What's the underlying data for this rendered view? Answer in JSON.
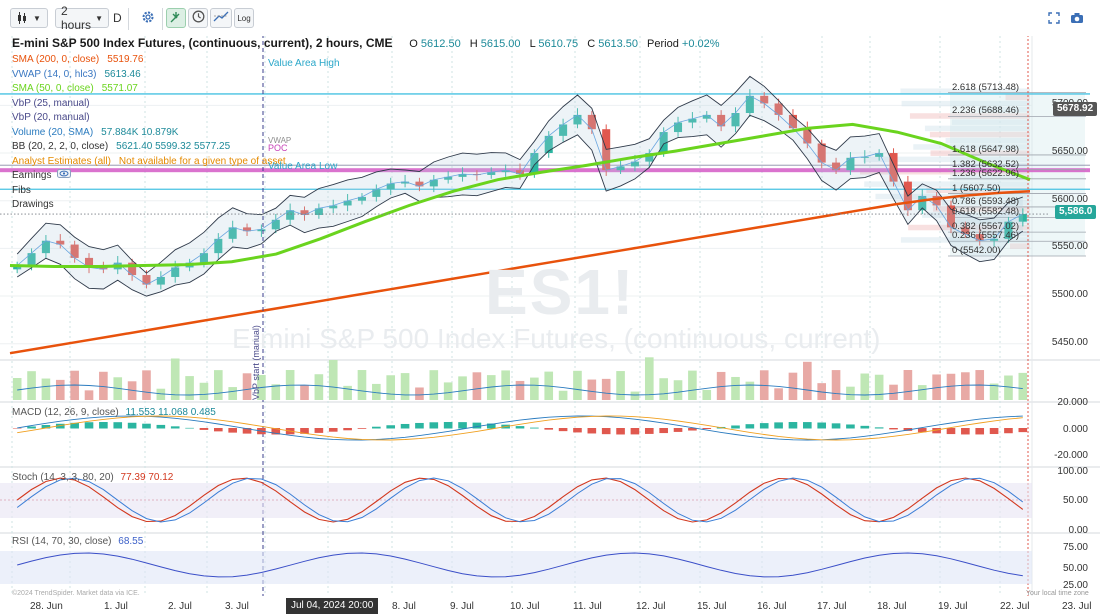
{
  "toolbar": {
    "chart_type_icon": "candlestick-icon",
    "interval": "2 hours",
    "period_code": "D",
    "settings_icon": "gear-icon",
    "active_tool_icon": "crosshair-cursor-icon",
    "clock_icon": "clock-icon",
    "drawing_icon": "pencil-line-icon",
    "log_label": "Log",
    "layout_icon": "expand-icon",
    "camera_icon": "camera-icon"
  },
  "header": {
    "title": "E-mini S&P 500 Index Futures, (continuous, current), 2 hours, CME",
    "open_label": "O",
    "open": "5612.50",
    "high_label": "H",
    "high": "5615.00",
    "low_label": "L",
    "low": "5610.75",
    "close_label": "C",
    "close": "5613.50",
    "period_label": "Period",
    "period_change": "+0.02%"
  },
  "legend": [
    {
      "name": "SMA (200, 0, close)",
      "value": "5519.76",
      "color": "#e8520c"
    },
    {
      "name": "VWAP (14, 0, hlc3)",
      "value": "5613.46",
      "color": "#3b78c2"
    },
    {
      "name": "SMA (50, 0, close)",
      "value": "5571.07",
      "color": "#6ad41e"
    },
    {
      "name": "VbP (25, manual)",
      "value": "",
      "color": "#4a4a8a"
    },
    {
      "name": "VbP (20, manual)",
      "value": "",
      "color": "#4a4a8a"
    },
    {
      "name": "Volume (20, SMA)",
      "value": "57.884K 10.879K",
      "color": "#2a7bbf"
    },
    {
      "name": "BB (20, 2, 2, 0, close)",
      "value": "5621.40 5599.32 5577.25",
      "color": "#333333"
    },
    {
      "name": "Analyst Estimates (all)",
      "value": "Not available for a given type of asset",
      "color": "#e48a00"
    },
    {
      "name": "Earnings",
      "value": "",
      "color": "#333333"
    },
    {
      "name": "Fibs",
      "value": "",
      "color": "#333333"
    },
    {
      "name": "Drawings",
      "value": "",
      "color": "#333333"
    }
  ],
  "watermark": {
    "symbol": "ES1!",
    "name": "E-mini S&P 500 Index Futures, (continuous, current)"
  },
  "annotations": {
    "value_area_high": "Value Area High",
    "value_area_low": "Value Area Low",
    "poc": "POC",
    "vwap": "VWAP",
    "vbp_start": "VbP start (manual)"
  },
  "fib_levels": [
    {
      "label": "2.618 (5713.48)",
      "price": 5713.48
    },
    {
      "label": "2.236 (5688.46)",
      "price": 5688.46
    },
    {
      "label": "1.618 (5647.98)",
      "price": 5647.98
    },
    {
      "label": "1.382 (5632.52)",
      "price": 5632.52
    },
    {
      "label": "1.236 (5622.96)",
      "price": 5622.96
    },
    {
      "label": "1 (5607.50)",
      "price": 5607.5
    },
    {
      "label": "0.786 (5593.48)",
      "price": 5593.48
    },
    {
      "label": "0.618 (5582.48)",
      "price": 5582.48
    },
    {
      "label": "0.382 (5567.02)",
      "price": 5567.02
    },
    {
      "label": "0.236 (5557.46)",
      "price": 5557.46
    },
    {
      "label": "0 (5542.00)",
      "price": 5542.0
    }
  ],
  "price_axis": {
    "ticks": [
      "5700.00",
      "5650.00",
      "5600.00",
      "5550.00",
      "5500.00",
      "5450.00"
    ],
    "tick_values": [
      5700,
      5650,
      5600,
      5550,
      5500,
      5450
    ],
    "range": [
      5435,
      5735
    ],
    "marker_gray": "5678.92",
    "marker_current": "5,586.0",
    "gray_color": "#555555",
    "current_color": "#26a69a"
  },
  "volume_axis": {
    "ticks": [
      "20.000"
    ]
  },
  "macd": {
    "label": "MACD (12, 26, 9, close)",
    "values": "11.553 11.068 0.485",
    "ticks": [
      "0.000",
      "-20.000"
    ]
  },
  "stoch": {
    "label": "Stoch (14, 3, 3, 80, 20)",
    "values": "77.39 70.12",
    "ticks": [
      "100.00",
      "50.00",
      "0.00"
    ]
  },
  "rsi": {
    "label": "RSI (14, 70, 30, close)",
    "value": "68.55",
    "ticks": [
      "75.00",
      "50.00",
      "25.00"
    ]
  },
  "time_axis": {
    "labels": [
      "28. Jun",
      "1. Jul",
      "2. Jul",
      "3. Jul",
      "8. Jul",
      "9. Jul",
      "10. Jul",
      "11. Jul",
      "12. Jul",
      "15. Jul",
      "16. Jul",
      "17. Jul",
      "18. Jul",
      "19. Jul",
      "22. Jul",
      "23. Jul"
    ],
    "cursor_label": "Jul 04, 2024 20:00"
  },
  "footer": {
    "copyright": "©2024 TrendSpider. Market data via ICE.",
    "local_time": "Your local time zone"
  },
  "chart_data": {
    "type": "candlestick",
    "symbol": "ES1!",
    "interval": "2 hours",
    "ylim": [
      5435,
      5735
    ],
    "dates": [
      "28. Jun",
      "1. Jul",
      "2. Jul",
      "3. Jul",
      "8. Jul",
      "9. Jul",
      "10. Jul",
      "11. Jul",
      "12. Jul",
      "15. Jul",
      "16. Jul",
      "17. Jul",
      "18. Jul",
      "19. Jul",
      "22. Jul",
      "23. Jul"
    ],
    "close_path": [
      5532,
      5545,
      5558,
      5554,
      5540,
      5530,
      5528,
      5535,
      5522,
      5512,
      5520,
      5530,
      5535,
      5545,
      5560,
      5572,
      5568,
      5570,
      5580,
      5590,
      5585,
      5592,
      5595,
      5600,
      5604,
      5612,
      5618,
      5620,
      5615,
      5622,
      5625,
      5628,
      5627,
      5630,
      5632,
      5628,
      5650,
      5668,
      5680,
      5690,
      5675,
      5632,
      5636,
      5641,
      5650,
      5672,
      5682,
      5686,
      5690,
      5678,
      5692,
      5710,
      5702,
      5690,
      5676,
      5660,
      5640,
      5632,
      5645,
      5646,
      5650,
      5620,
      5590,
      5605,
      5595,
      5572,
      5565,
      5558,
      5560,
      5578,
      5586
    ],
    "sma200": [
      5440,
      5446,
      5452,
      5458,
      5464,
      5470,
      5476,
      5482,
      5488,
      5494,
      5500,
      5506,
      5512,
      5518,
      5524,
      5530,
      5536,
      5542,
      5548,
      5554,
      5560,
      5566,
      5572,
      5578,
      5584,
      5590,
      5596,
      5601,
      5605,
      5608,
      5610
    ],
    "sma50": [
      5532,
      5531,
      5531,
      5532,
      5533,
      5536,
      5544,
      5560,
      5578,
      5595,
      5610,
      5622,
      5630,
      5637,
      5645,
      5652,
      5660,
      5668,
      5676,
      5680,
      5672,
      5660,
      5640,
      5622
    ],
    "value_area_high": 5712,
    "value_area_low": 5612,
    "poc": 5632,
    "rsi_value": 68.55,
    "stoch_values": [
      77.39,
      70.12
    ],
    "macd_values": [
      11.553,
      11.068,
      0.485
    ],
    "legend_placement": "top-left"
  }
}
